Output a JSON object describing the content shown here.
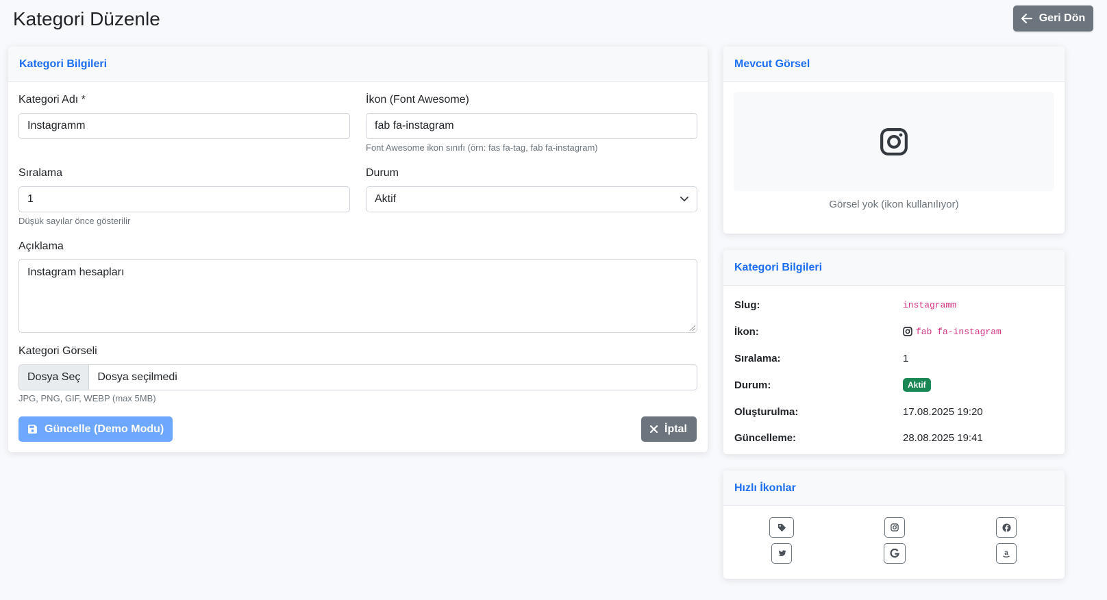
{
  "page": {
    "title": "Kategori Düzenle",
    "back_label": "Geri Dön"
  },
  "form_card": {
    "header": "Kategori Bilgileri",
    "name_label": "Kategori Adı *",
    "name_value": "Instagramm",
    "icon_label": "İkon (Font Awesome)",
    "icon_value": "fab fa-instagram",
    "icon_hint": "Font Awesome ikon sınıfı (örn: fas fa-tag, fab fa-instagram)",
    "order_label": "Sıralama",
    "order_value": "1",
    "order_hint": "Düşük sayılar önce gösterilir",
    "status_label": "Durum",
    "status_value": "Aktif",
    "desc_label": "Açıklama",
    "desc_value": "Instagram hesapları",
    "image_label": "Kategori Görseli",
    "file_button": "Dosya Seç",
    "file_name": "Dosya seçilmedi",
    "image_hint": "JPG, PNG, GIF, WEBP (max 5MB)",
    "submit_label": "Güncelle (Demo Modu)",
    "cancel_label": "İptal"
  },
  "current_image_card": {
    "header": "Mevcut Görsel",
    "preview_icon": "instagram-icon",
    "caption": "Görsel yok (ikon kullanılıyor)"
  },
  "info_card": {
    "header": "Kategori Bilgileri",
    "rows": [
      {
        "key": "Slug:",
        "value": "instagramm"
      },
      {
        "key": "İkon:",
        "value": "fab fa-instagram"
      },
      {
        "key": "Sıralama:",
        "value": "1"
      },
      {
        "key": "Durum:",
        "value": "Aktif"
      },
      {
        "key": "Oluşturulma:",
        "value": "17.08.2025 19:20"
      },
      {
        "key": "Güncelleme:",
        "value": "28.08.2025 19:41"
      }
    ]
  },
  "quick_icons_card": {
    "header": "Hızlı İkonlar",
    "icons": [
      "tag-icon",
      "instagram-icon",
      "facebook-icon",
      "twitter-icon",
      "google-icon",
      "amazon-icon"
    ]
  },
  "colors": {
    "accent": "#1c6ef2",
    "primary_button": "#6ea8fe",
    "secondary_button": "#6c757d",
    "success_badge": "#198754",
    "code": "#d63384"
  }
}
